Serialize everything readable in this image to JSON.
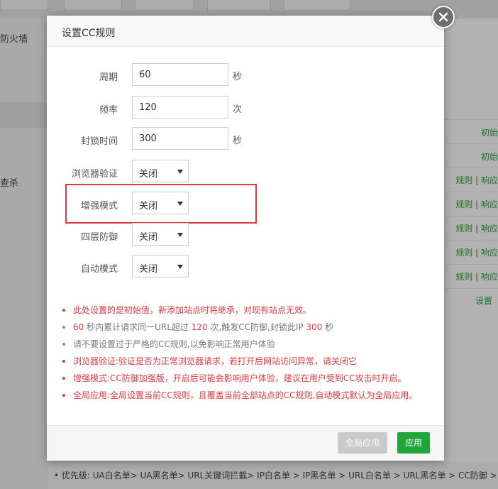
{
  "background": {
    "side_title": "防火墙",
    "side_text": "查杀",
    "right_links": [
      {
        "text": "初始"
      },
      {
        "text": "初始"
      },
      {
        "a": "规则",
        "b": "响应"
      },
      {
        "a": "规则",
        "b": "响应"
      },
      {
        "a": "规则",
        "b": "响应"
      },
      {
        "a": "规则",
        "b": "响应"
      },
      {
        "a": "规则",
        "b": "响应"
      },
      {
        "text": "设置"
      }
    ],
    "priority_text": "• 优先级: UA白名单> UA黑名单> URL关键词拦截> IP白名单 > IP黑名单 > URL白名单 > URL黑名单 > CC防御 >"
  },
  "modal": {
    "title": "设置CC规则",
    "fields": {
      "period": {
        "label": "周期",
        "value": "60",
        "unit": "秒"
      },
      "frequency": {
        "label": "频率",
        "value": "120",
        "unit": "次"
      },
      "ban_time": {
        "label": "封锁时间",
        "value": "300",
        "unit": "秒"
      },
      "browser_verify": {
        "label": "浏览器验证",
        "value": "关闭"
      },
      "enhanced_mode": {
        "label": "增强模式",
        "value": "关闭"
      },
      "layer4_defense": {
        "label": "四层防御",
        "value": "关闭"
      },
      "auto_mode": {
        "label": "自动模式",
        "value": "关闭"
      }
    },
    "notes": {
      "n1": "此处设置的是初始值，新添加站点时将继承，对现有站点无效。",
      "n2a": "60",
      "n2b": " 秒内累计请求同一URL超过 ",
      "n2c": "120",
      "n2d": " 次,触发CC防御,封锁此IP ",
      "n2e": "300",
      "n2f": " 秒",
      "n3": "请不要设置过于严格的CC规则,以免影响正常用户体验",
      "n4": "浏览器验证:验证是否为正常浏览器请求，若打开后网站访问异常，请关闭它",
      "n5": "增强模式:CC防御加强版，开启后可能会影响用户体验，建议在用户受到CC攻击时开启。",
      "n6": "全局应用:全局设置当前CC规则，且覆盖当前全部站点的CC规则,自动模式默认为全局应用。"
    },
    "buttons": {
      "global_apply": "全局应用",
      "apply": "应用"
    },
    "colors": {
      "accent": "#20a53a",
      "warning": "#e0393e"
    }
  }
}
